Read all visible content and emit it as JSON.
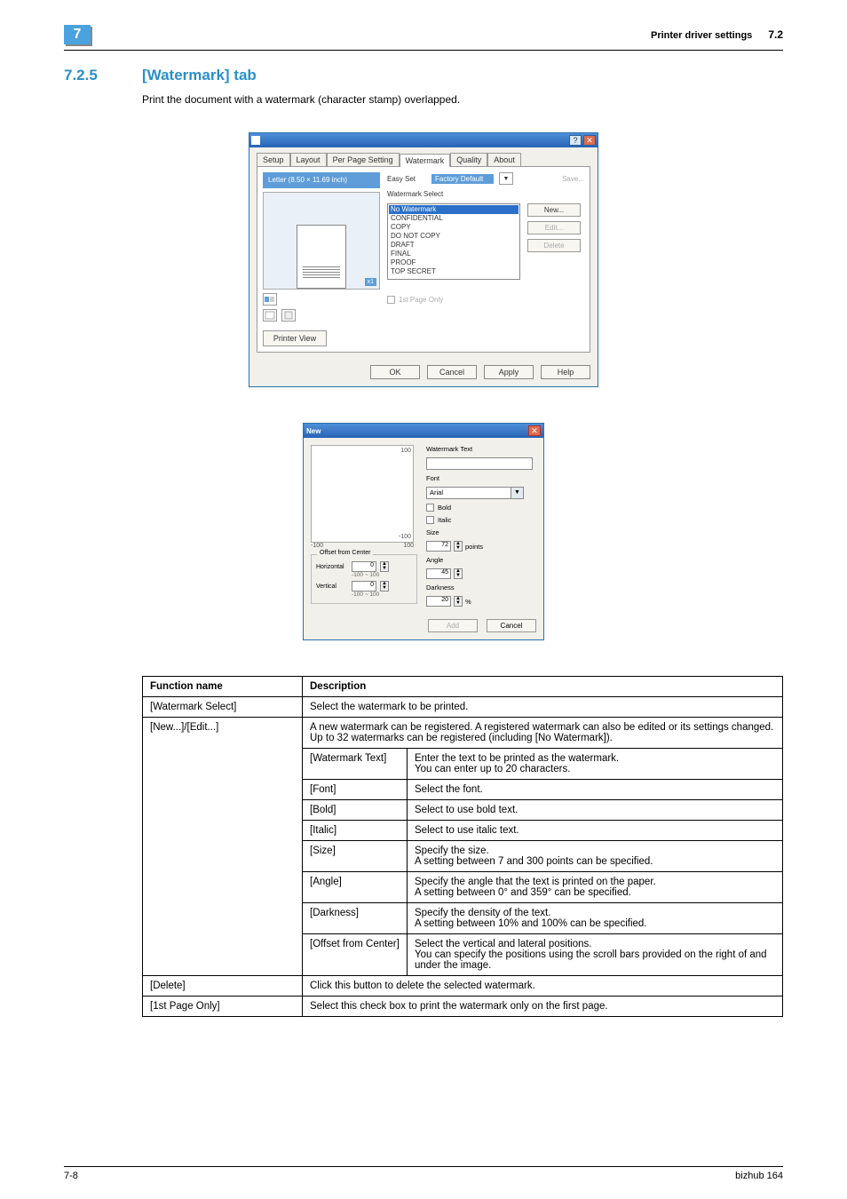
{
  "header": {
    "chapter": "7",
    "title": "Printer driver settings",
    "section_num": "7.2"
  },
  "heading": {
    "num": "7.2.5",
    "text": "[Watermark] tab"
  },
  "intro": "Print the document with a watermark (character stamp) overlapped.",
  "dlg1": {
    "tabs": [
      "Setup",
      "Layout",
      "Per Page Setting",
      "Watermark",
      "Quality",
      "About"
    ],
    "paper_size": "Letter (8.50 × 11.69 inch)",
    "preview_tag": "x1",
    "printer_view": "Printer View",
    "easy_set_label": "Easy Set",
    "easy_set_value": "Factory Default",
    "easy_set_save": "Save...",
    "wm_select_label": "Watermark Select",
    "wm_items": [
      "No Watermark",
      "CONFIDENTIAL",
      "COPY",
      "DO NOT COPY",
      "DRAFT",
      "FINAL",
      "PROOF",
      "TOP SECRET"
    ],
    "btn_new": "New...",
    "btn_edit": "Edit...",
    "btn_delete": "Delete",
    "chk_first": "1st Page Only",
    "ok": "OK",
    "cancel": "Cancel",
    "apply": "Apply",
    "help": "Help"
  },
  "dlg2": {
    "title": "New",
    "axis_top": "100",
    "axis_bottom": "-100",
    "axis_left": "-100",
    "axis_right": "100",
    "offset_title": "Offset from Center",
    "horizontal": "Horizontal",
    "vertical": "Vertical",
    "range": "-100 ~ 100",
    "zero": "0",
    "wm_text_label": "Watermark Text",
    "font_label": "Font",
    "font_value": "Arial",
    "bold": "Bold",
    "italic": "Italic",
    "size_label": "Size",
    "size_value": "72",
    "size_unit": "points",
    "angle_label": "Angle",
    "angle_value": "45",
    "darkness_label": "Darkness",
    "darkness_value": "20",
    "darkness_unit": "%",
    "add": "Add",
    "cancel": "Cancel"
  },
  "table": {
    "h1": "Function name",
    "h2": "Description",
    "r1c1": "[Watermark Select]",
    "r1c2": "Select the watermark to be printed.",
    "r2c1": "[New...]/[Edit...]",
    "r2c2": "A new watermark can be registered. A registered watermark can also be edited or its settings changed.\nUp to 32 watermarks can be registered (including [No Watermark]).",
    "r3a": "[Watermark Text]",
    "r3b": "Enter the text to be printed as the watermark.\nYou can enter up to 20 characters.",
    "r4a": "[Font]",
    "r4b": "Select the font.",
    "r5a": "[Bold]",
    "r5b": "Select to use bold text.",
    "r6a": "[Italic]",
    "r6b": "Select to use italic text.",
    "r7a": "[Size]",
    "r7b": "Specify the size.\nA setting between 7 and 300 points can be specified.",
    "r8a": "[Angle]",
    "r8b": "Specify the angle that the text is printed on the paper.\nA setting between 0° and 359° can be specified.",
    "r9a": "[Darkness]",
    "r9b": "Specify the density of the text.\nA setting between 10% and 100% can be specified.",
    "r10a": "[Offset from Center]",
    "r10b": "Select the vertical and lateral positions.\nYou can specify the positions using the scroll bars provided on the right of and under the image.",
    "r11a": "[Delete]",
    "r11b": "Click this button to delete the selected watermark.",
    "r12a": "[1st Page Only]",
    "r12b": "Select this check box to print the watermark only on the first page."
  },
  "footer": {
    "page": "7-8",
    "product": "bizhub 164"
  }
}
